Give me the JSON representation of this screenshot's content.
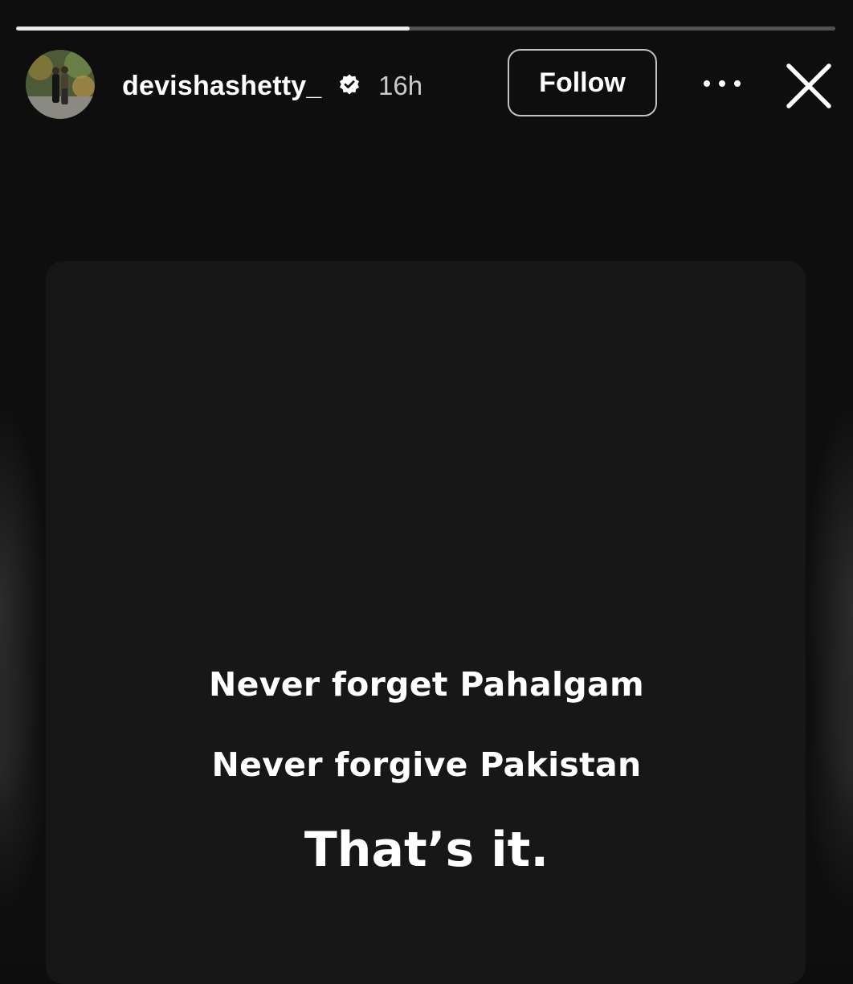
{
  "story": {
    "progress_fraction": 0.48,
    "username": "devishashetty_",
    "verified": true,
    "timestamp": "16h",
    "follow_label": "Follow",
    "icons": {
      "avatar": "profile-avatar",
      "verified": "verified-badge-icon",
      "more": "more-horizontal-icon",
      "close": "close-icon"
    },
    "lines": [
      "Never forget Pahalgam",
      "Never forgive Pakistan",
      "That’s it."
    ]
  },
  "colors": {
    "background": "#0e0e0e",
    "card": "#171717",
    "text": "#ffffff"
  }
}
